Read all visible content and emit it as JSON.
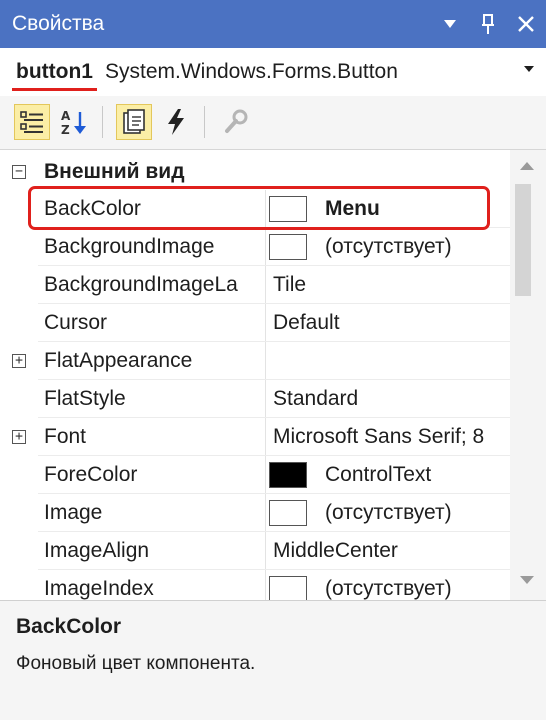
{
  "window": {
    "title": "Свойства"
  },
  "object": {
    "name": "button1",
    "type": "System.Windows.Forms.Button"
  },
  "category": {
    "label": "Внешний вид",
    "expanded": true
  },
  "properties": [
    {
      "name": "BackColor",
      "value": "Menu",
      "swatch": "#ffffff",
      "bold": true,
      "expander": false
    },
    {
      "name": "BackgroundImage",
      "value": "(отсутствует)",
      "swatch": "#ffffff",
      "bold": false,
      "expander": false
    },
    {
      "name": "BackgroundImageLa",
      "value": "Tile",
      "swatch": null,
      "bold": false,
      "expander": false
    },
    {
      "name": "Cursor",
      "value": "Default",
      "swatch": null,
      "bold": false,
      "expander": false
    },
    {
      "name": "FlatAppearance",
      "value": "",
      "swatch": null,
      "bold": false,
      "expander": true
    },
    {
      "name": "FlatStyle",
      "value": "Standard",
      "swatch": null,
      "bold": false,
      "expander": false
    },
    {
      "name": "Font",
      "value": "Microsoft Sans Serif; 8",
      "swatch": null,
      "bold": false,
      "expander": true
    },
    {
      "name": "ForeColor",
      "value": "ControlText",
      "swatch": "#000000",
      "bold": false,
      "expander": false
    },
    {
      "name": "Image",
      "value": "(отсутствует)",
      "swatch": "#ffffff",
      "bold": false,
      "expander": false
    },
    {
      "name": "ImageAlign",
      "value": "MiddleCenter",
      "swatch": null,
      "bold": false,
      "expander": false
    },
    {
      "name": "ImageIndex",
      "value": "(отсутствует)",
      "swatch": "#ffffff",
      "bold": false,
      "expander": false
    }
  ],
  "description": {
    "title": "BackColor",
    "text": "Фоновый цвет компонента."
  },
  "colors": {
    "titlebar": "#4b72c2",
    "highlight": "#e0201c",
    "active_tool": "#fbeea6"
  },
  "icons": [
    "dropdown-icon",
    "pin-icon",
    "close-icon",
    "categorized-icon",
    "alphabetical-icon",
    "properties-icon",
    "events-icon",
    "property-pages-icon"
  ]
}
